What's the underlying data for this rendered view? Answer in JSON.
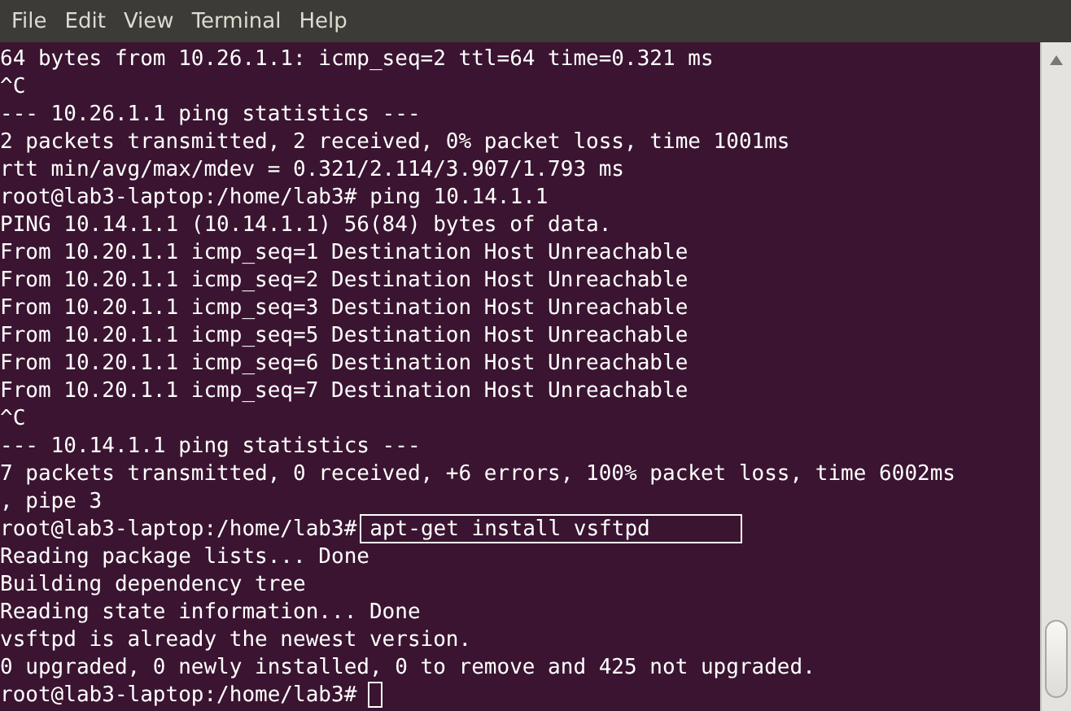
{
  "menu": [
    "File",
    "Edit",
    "View",
    "Terminal",
    "Help"
  ],
  "lines": [
    {
      "kind": "output",
      "text": "64 bytes from 10.26.1.1: icmp_seq=2 ttl=64 time=0.321 ms"
    },
    {
      "kind": "output",
      "text": "^C"
    },
    {
      "kind": "output",
      "text": "--- 10.26.1.1 ping statistics ---"
    },
    {
      "kind": "output",
      "text": "2 packets transmitted, 2 received, 0% packet loss, time 1001ms"
    },
    {
      "kind": "output",
      "text": "rtt min/avg/max/mdev = 0.321/2.114/3.907/1.793 ms"
    },
    {
      "kind": "prompt",
      "prompt": "root@lab3-laptop:/home/lab3#",
      "command": "ping 10.14.1.1",
      "highlighted": false
    },
    {
      "kind": "output",
      "text": "PING 10.14.1.1 (10.14.1.1) 56(84) bytes of data."
    },
    {
      "kind": "output",
      "text": "From 10.20.1.1 icmp_seq=1 Destination Host Unreachable"
    },
    {
      "kind": "output",
      "text": "From 10.20.1.1 icmp_seq=2 Destination Host Unreachable"
    },
    {
      "kind": "output",
      "text": "From 10.20.1.1 icmp_seq=3 Destination Host Unreachable"
    },
    {
      "kind": "output",
      "text": "From 10.20.1.1 icmp_seq=5 Destination Host Unreachable"
    },
    {
      "kind": "output",
      "text": "From 10.20.1.1 icmp_seq=6 Destination Host Unreachable"
    },
    {
      "kind": "output",
      "text": "From 10.20.1.1 icmp_seq=7 Destination Host Unreachable"
    },
    {
      "kind": "output",
      "text": "^C"
    },
    {
      "kind": "output",
      "text": "--- 10.14.1.1 ping statistics ---"
    },
    {
      "kind": "output",
      "text": "7 packets transmitted, 0 received, +6 errors, 100% packet loss, time 6002ms"
    },
    {
      "kind": "output",
      "text": ", pipe 3"
    },
    {
      "kind": "prompt",
      "prompt": "root@lab3-laptop:/home/lab3#",
      "command": "apt-get install vsftpd",
      "highlighted": true
    },
    {
      "kind": "output",
      "text": "Reading package lists... Done"
    },
    {
      "kind": "output",
      "text": "Building dependency tree"
    },
    {
      "kind": "output",
      "text": "Reading state information... Done"
    },
    {
      "kind": "output",
      "text": "vsftpd is already the newest version."
    },
    {
      "kind": "output",
      "text": "0 upgraded, 0 newly installed, 0 to remove and 425 not upgraded."
    },
    {
      "kind": "cursor",
      "prompt": "root@lab3-laptop:/home/lab3#"
    }
  ]
}
